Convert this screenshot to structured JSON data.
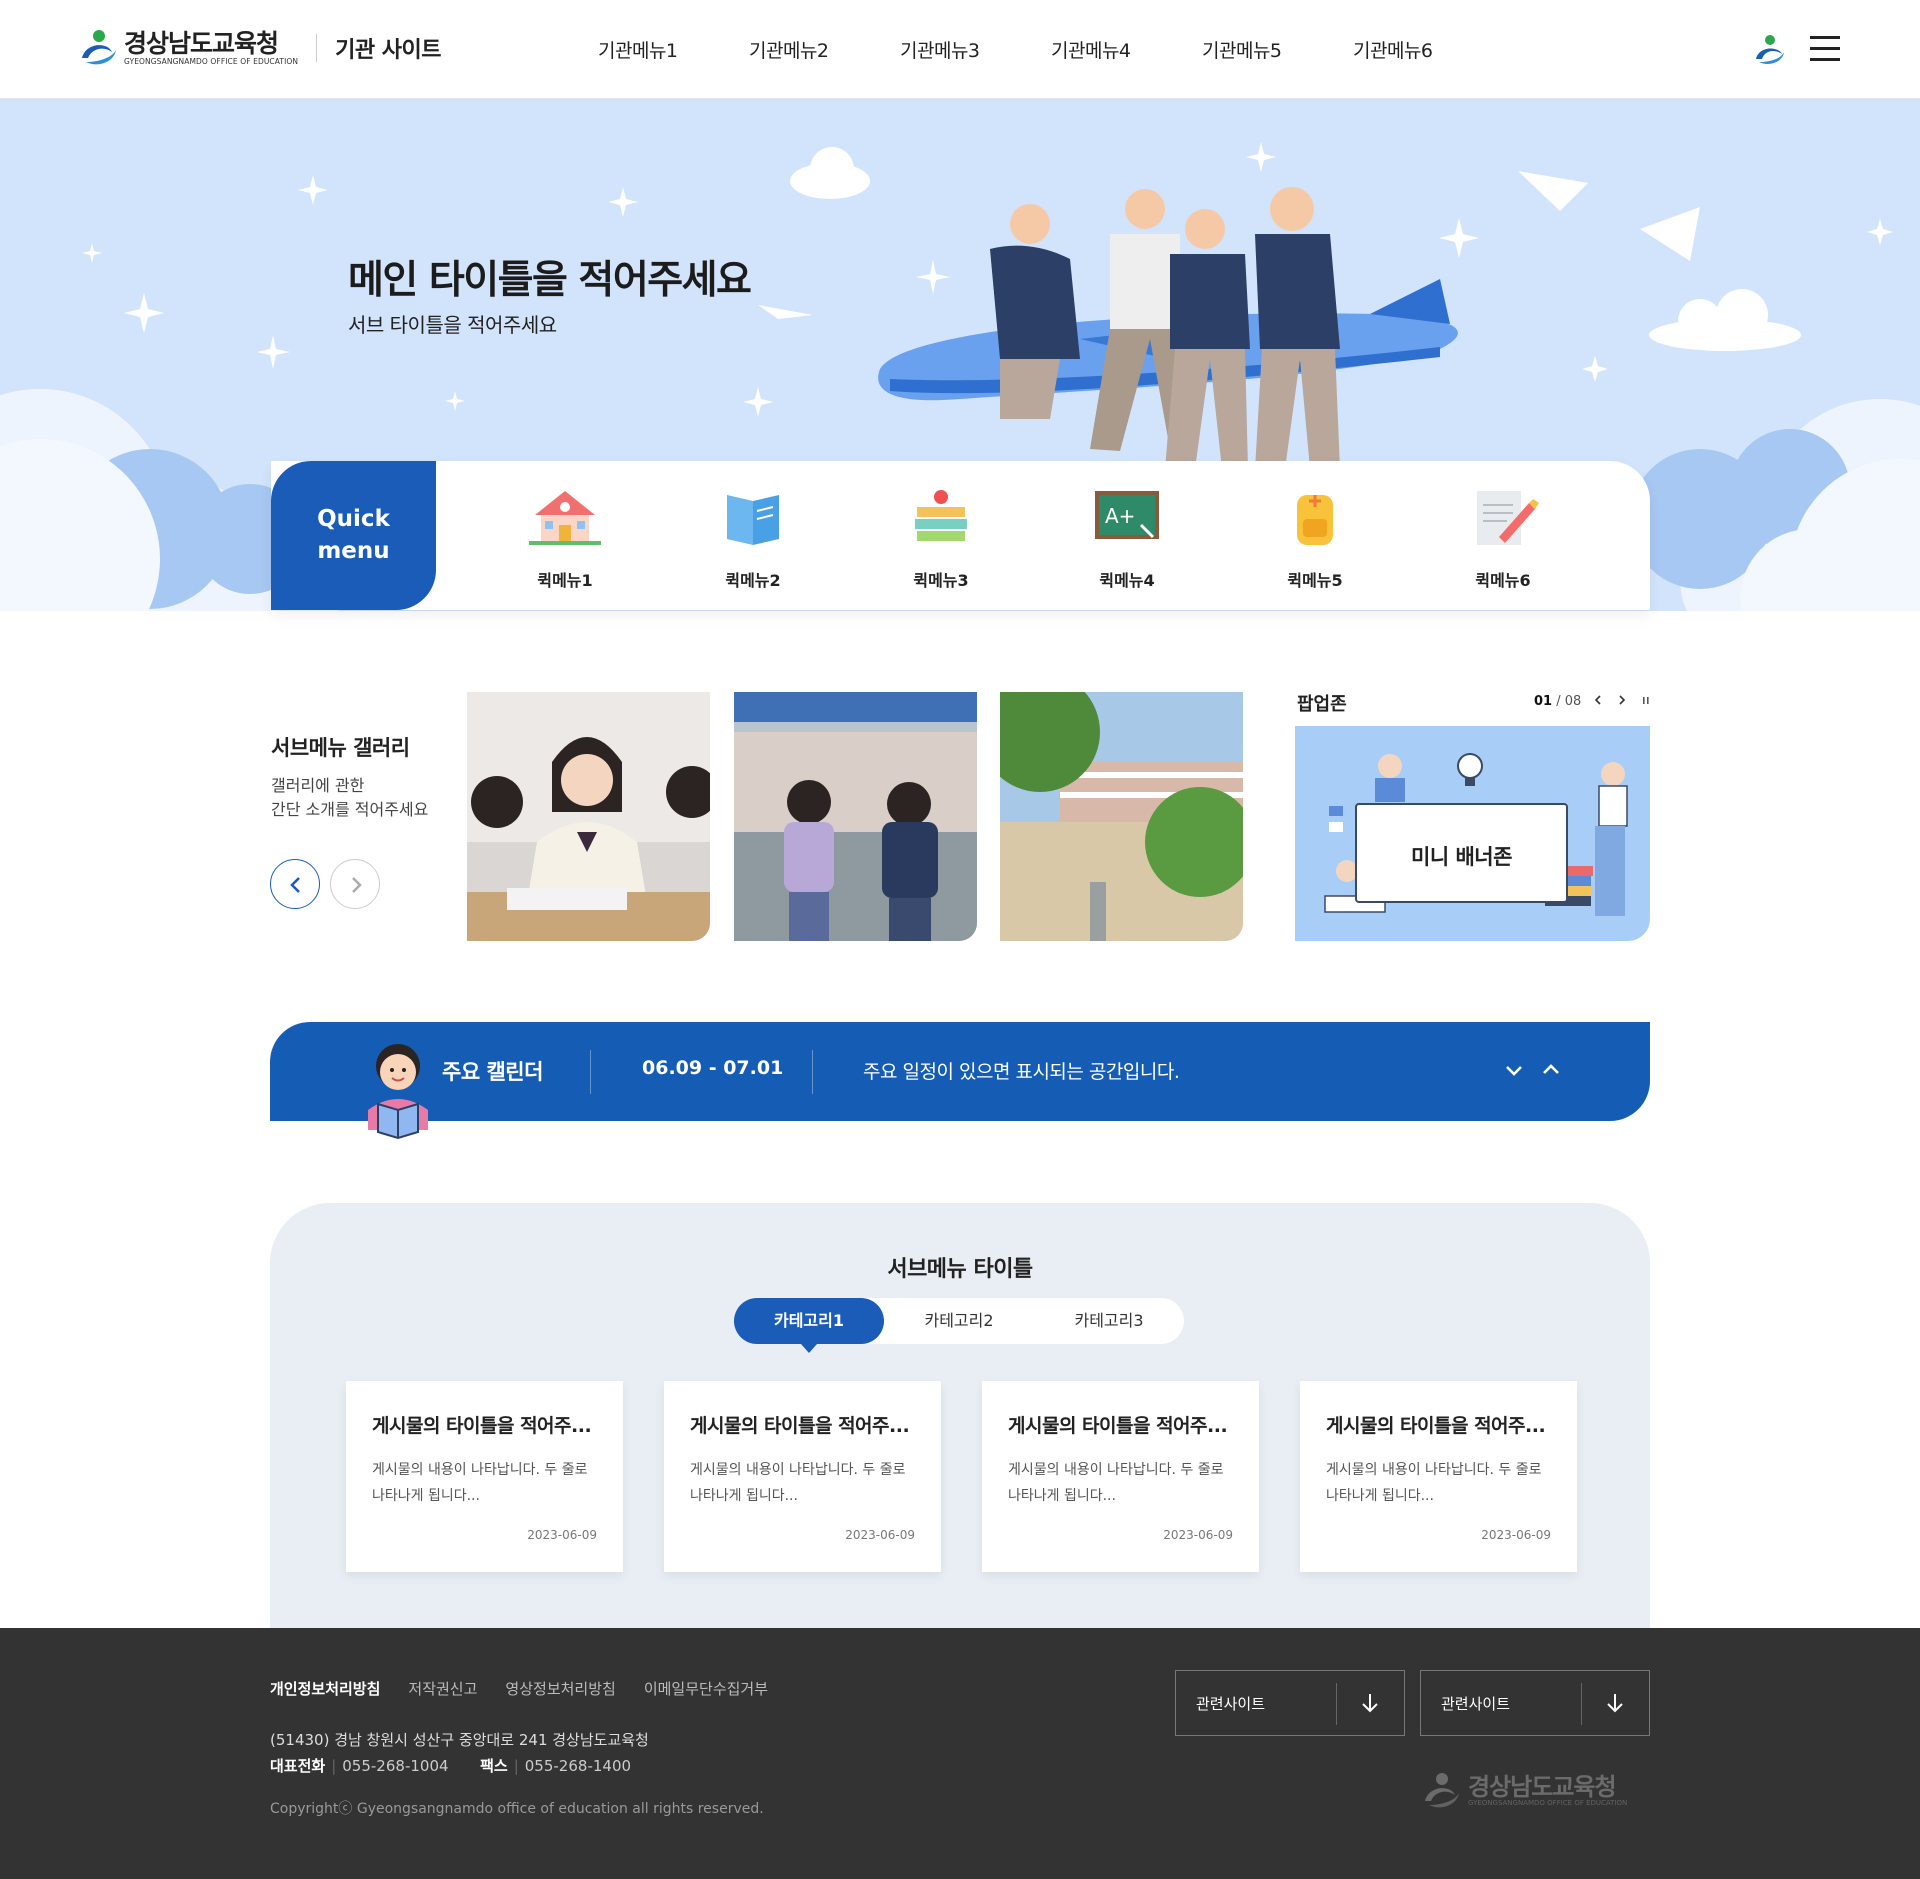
{
  "header": {
    "logo_ko": "경상남도교육청",
    "logo_en": "GYEONGSANGNAMDO OFFICE OF EDUCATION",
    "site_name": "기관 사이트",
    "gnb": [
      "기관메뉴1",
      "기관메뉴2",
      "기관메뉴3",
      "기관메뉴4",
      "기관메뉴5",
      "기관메뉴6"
    ]
  },
  "hero": {
    "title": "메인 타이틀을 적어주세요",
    "subtitle": "서브 타이틀을 적어주세요"
  },
  "quick": {
    "label_line1": "Quick",
    "label_line2": "menu",
    "items": [
      {
        "label": "퀵메뉴1",
        "icon": "school-icon"
      },
      {
        "label": "퀵메뉴2",
        "icon": "book-icon"
      },
      {
        "label": "퀵메뉴3",
        "icon": "books-apple-icon"
      },
      {
        "label": "퀵메뉴4",
        "icon": "blackboard-icon"
      },
      {
        "label": "퀵메뉴5",
        "icon": "backpack-icon"
      },
      {
        "label": "퀵메뉴6",
        "icon": "note-pencil-icon"
      }
    ]
  },
  "gallery": {
    "title": "서브메뉴 갤러리",
    "desc_line1": "갤러리에 관한",
    "desc_line2": "간단 소개를 적어주세요"
  },
  "popup": {
    "title": "팝업존",
    "current": "01",
    "total": "/ 08",
    "banner_text": "미니 배너존"
  },
  "calendar": {
    "title": "주요 캘린더",
    "date": "06.09 - 07.01",
    "text": "주요 일정이 있으면 표시되는 공간입니다."
  },
  "board": {
    "title": "서브메뉴 타이틀",
    "tabs": [
      "카테고리1",
      "카테고리2",
      "카테고리3"
    ],
    "posts": [
      {
        "title": "게시물의 타이틀을 적어주...",
        "body_line1": "게시물의 내용이 나타납니다. 두 줄로",
        "body_line2": "나타나게 됩니다...",
        "date": "2023-06-09"
      },
      {
        "title": "게시물의 타이틀을 적어주...",
        "body_line1": "게시물의 내용이 나타납니다. 두 줄로",
        "body_line2": "나타나게 됩니다...",
        "date": "2023-06-09"
      },
      {
        "title": "게시물의 타이틀을 적어주...",
        "body_line1": "게시물의 내용이 나타납니다. 두 줄로",
        "body_line2": "나타나게 됩니다...",
        "date": "2023-06-09"
      },
      {
        "title": "게시물의 타이틀을 적어주...",
        "body_line1": "게시물의 내용이 나타납니다. 두 줄로",
        "body_line2": "나타나게 됩니다...",
        "date": "2023-06-09"
      }
    ]
  },
  "footer": {
    "links": [
      "개인정보처리방침",
      "저작권신고",
      "영상정보처리방침",
      "이메일무단수집거부"
    ],
    "address": "(51430) 경남 창원시 성산구 중앙대로 241 경상남도교육청",
    "tel_label": "대표전화",
    "tel": "055-268-1004",
    "fax_label": "팩스",
    "fax": "055-268-1400",
    "copyright": "Copyrightⓒ Gyeongsangnamdo office of education all rights reserved.",
    "selects": [
      "관련사이트",
      "관련사이트"
    ],
    "logo_ko": "경상남도교육청",
    "logo_en": "GYEONGSANGNAMDO OFFICE OF EDUCATION"
  },
  "colors": {
    "primary": "#1a5cb8",
    "hero_bg": "#d2e4fb",
    "board_bg": "#e8eef3",
    "footer_bg": "#333333"
  }
}
